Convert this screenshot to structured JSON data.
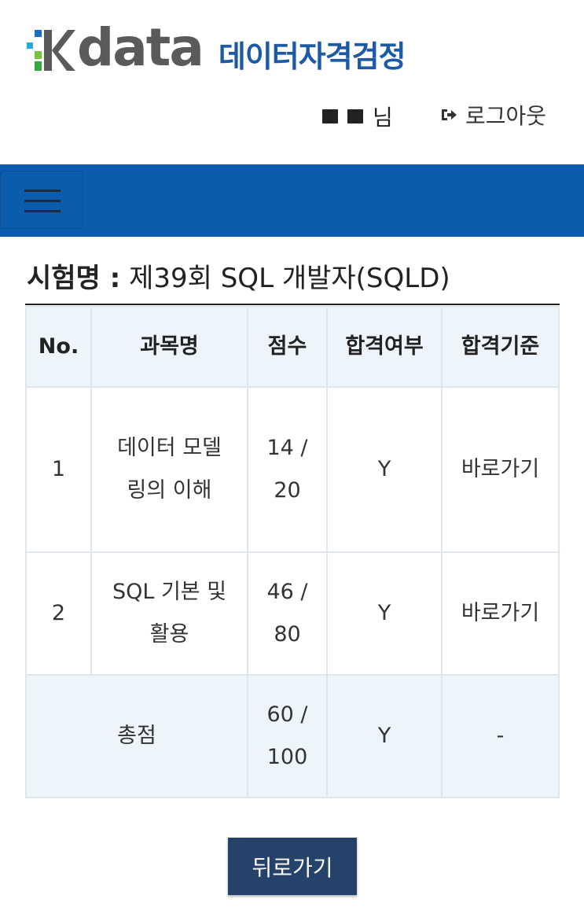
{
  "header": {
    "logo_text": "data",
    "logo_subtitle": "데이터자격검정",
    "user_suffix": "님",
    "logout_label": "로그아웃"
  },
  "exam": {
    "label": "시험명 :",
    "name": "제39회 SQL 개발자(SQLD)"
  },
  "table": {
    "headers": [
      "No.",
      "과목명",
      "점수",
      "합격여부",
      "합격기준"
    ],
    "rows": [
      {
        "no": "1",
        "subject": "데이터 모델링의 이해",
        "score": "14 / 20",
        "pass": "Y",
        "criteria": "바로가기"
      },
      {
        "no": "2",
        "subject": "SQL 기본 및 활용",
        "score": "46 / 80",
        "pass": "Y",
        "criteria": "바로가기"
      }
    ],
    "total": {
      "label": "총점",
      "score": "60 / 100",
      "pass": "Y",
      "criteria": "-"
    }
  },
  "back_button_label": "뒤로가기",
  "colors": {
    "navbar": "#0b5cad",
    "brand_text": "#1d5aa6",
    "button": "#24426a",
    "header_cell": "#eef4fb"
  }
}
